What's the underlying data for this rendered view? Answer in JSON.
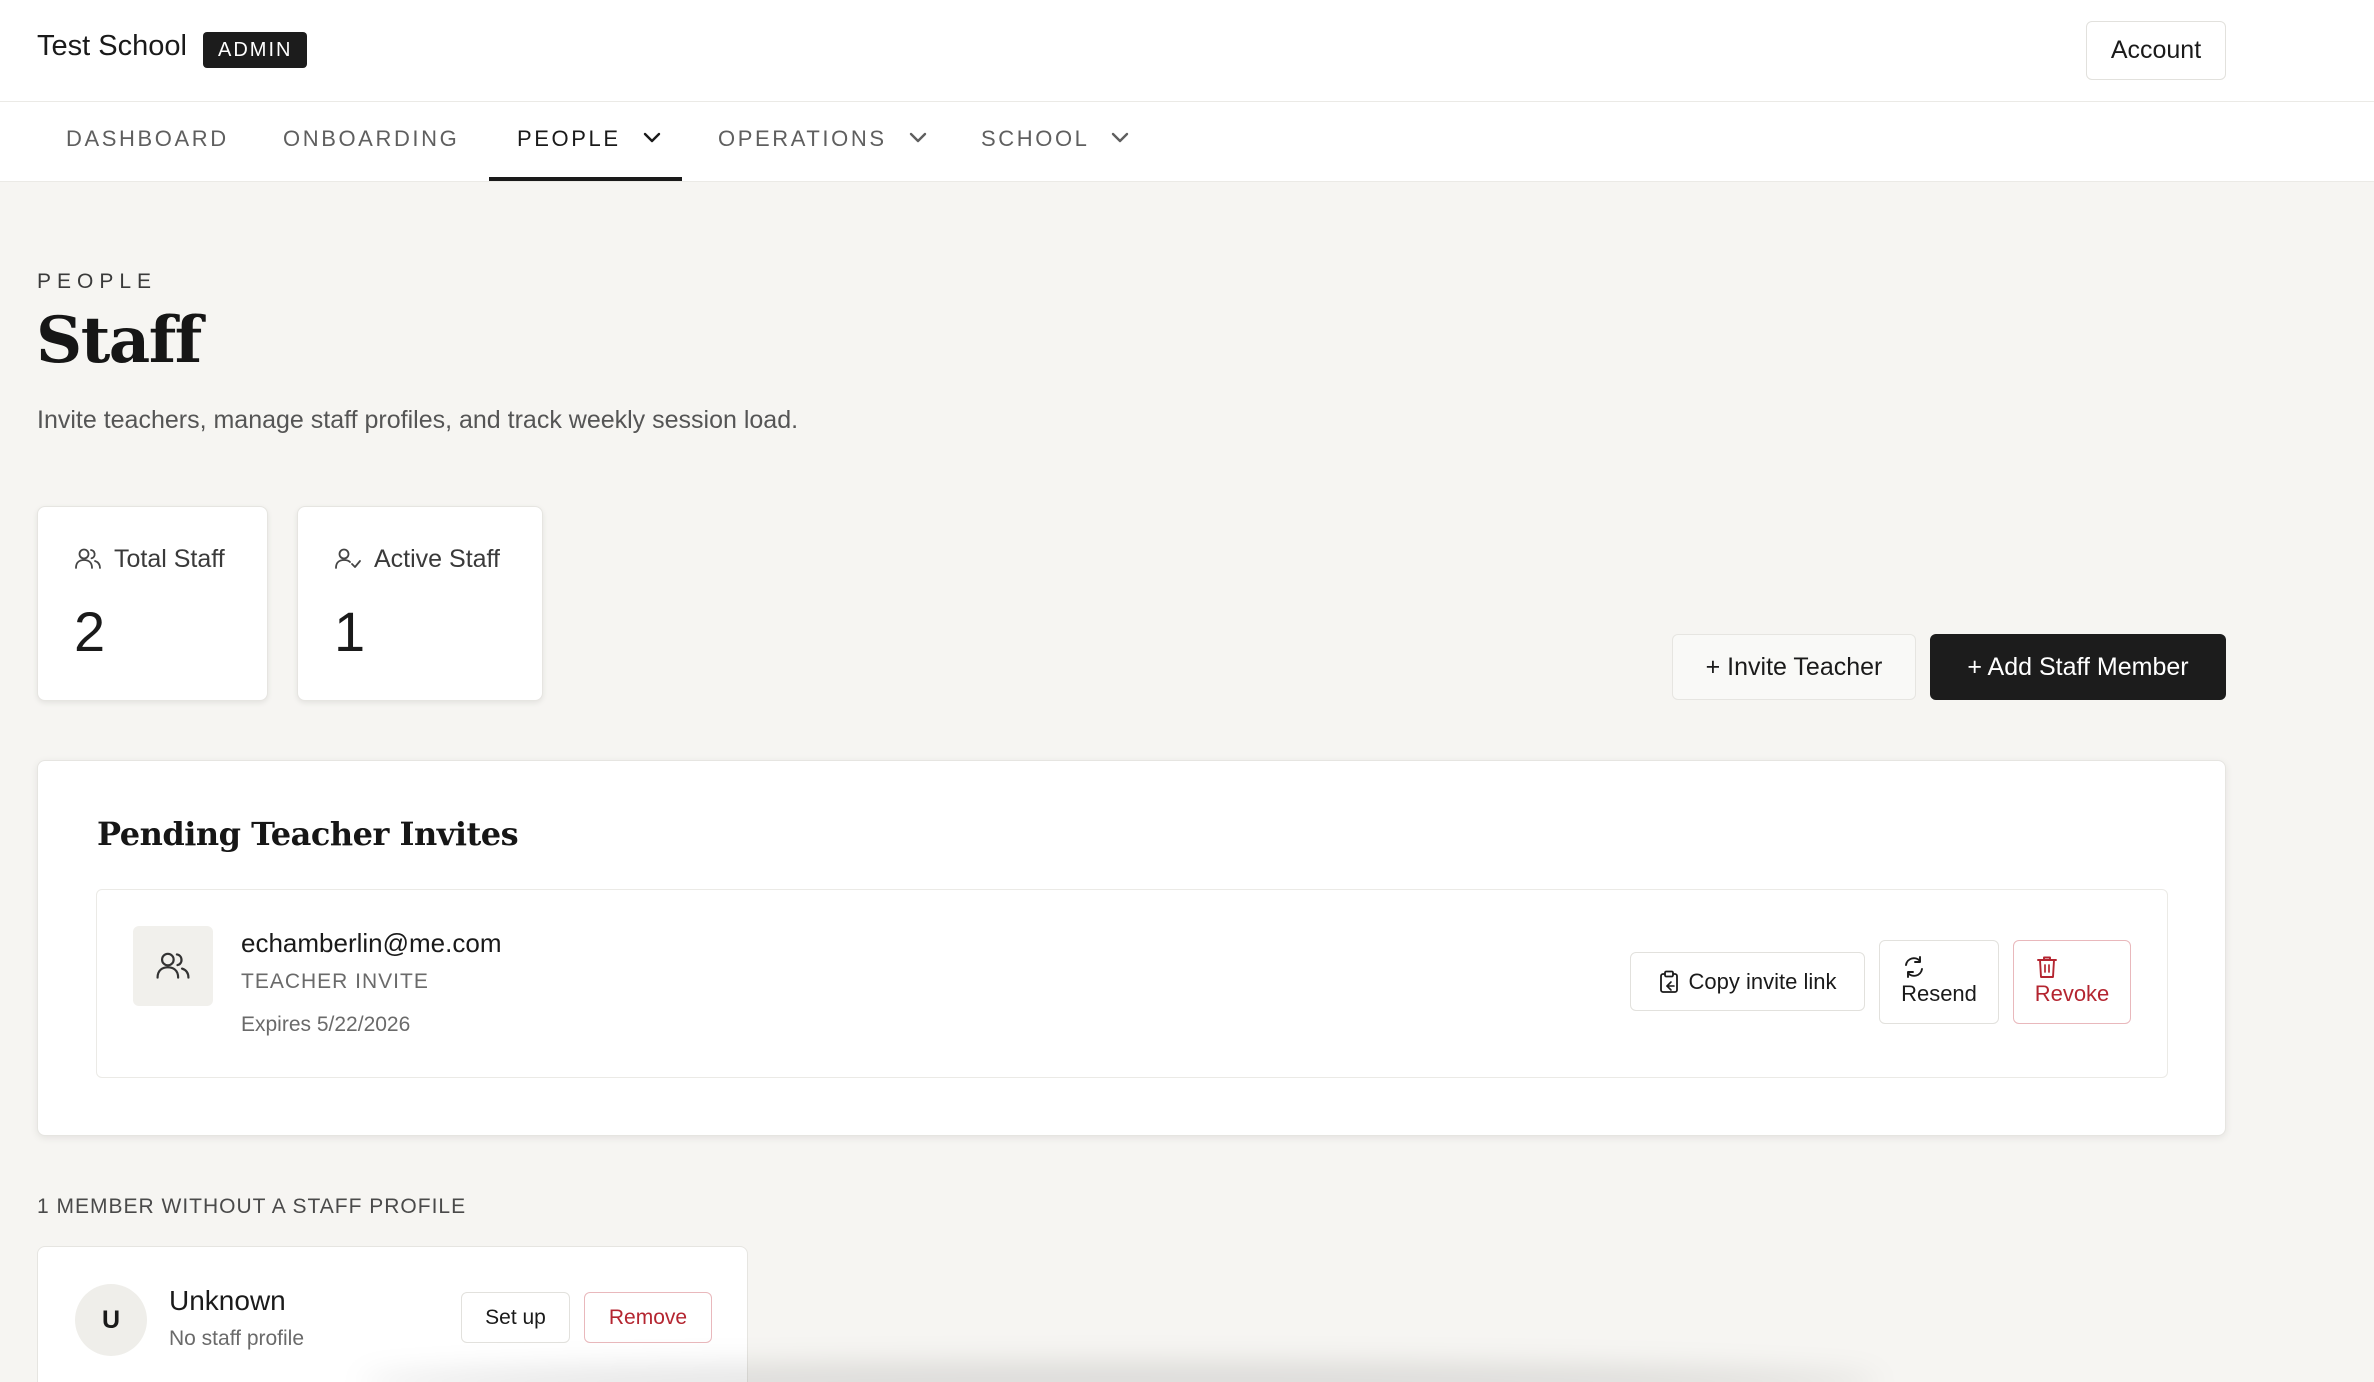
{
  "header": {
    "school_name": "Test School",
    "role_badge": "ADMIN",
    "account_label": "Account"
  },
  "nav": {
    "items": [
      {
        "label": "DASHBOARD",
        "has_dropdown": false
      },
      {
        "label": "ONBOARDING",
        "has_dropdown": false
      },
      {
        "label": "PEOPLE",
        "has_dropdown": true,
        "active": true
      },
      {
        "label": "OPERATIONS",
        "has_dropdown": true
      },
      {
        "label": "SCHOOL",
        "has_dropdown": true
      }
    ]
  },
  "page": {
    "eyebrow": "PEOPLE",
    "title": "Staff",
    "subtitle": "Invite teachers, manage staff profiles, and track weekly session load."
  },
  "stats": [
    {
      "label": "Total Staff",
      "value": "2",
      "icon": "users-icon"
    },
    {
      "label": "Active Staff",
      "value": "1",
      "icon": "user-check-icon"
    }
  ],
  "actions": {
    "invite_teacher": "+ Invite Teacher",
    "add_staff": "+ Add Staff Member"
  },
  "pending_invites": {
    "title": "Pending Teacher Invites",
    "items": [
      {
        "email": "echamberlin@me.com",
        "type": "TEACHER INVITE",
        "expires": "Expires 5/22/2026",
        "copy_label": "Copy invite link",
        "resend_label": "Resend",
        "revoke_label": "Revoke"
      }
    ]
  },
  "unprofiled": {
    "label": "1 MEMBER WITHOUT A STAFF PROFILE",
    "members": [
      {
        "initial": "U",
        "name": "Unknown",
        "subtitle": "No staff profile",
        "setup_label": "Set up",
        "remove_label": "Remove"
      }
    ]
  },
  "colors": {
    "background": "#f6f5f2",
    "primary_dark": "#1c1c1c",
    "danger": "#b42530"
  }
}
